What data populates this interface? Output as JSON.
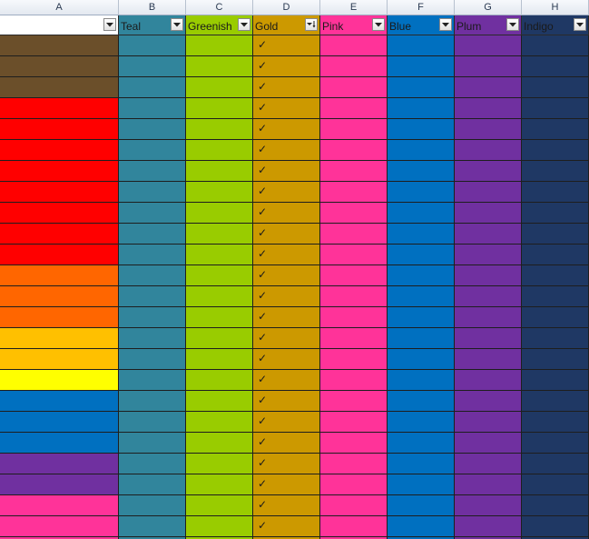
{
  "column_letters": [
    "A",
    "B",
    "C",
    "D",
    "E",
    "F",
    "G",
    "H"
  ],
  "filter_headers": [
    {
      "label": "",
      "bg": "#ffffff",
      "button_icon": "filter-dropdown-icon"
    },
    {
      "label": "Teal",
      "bg": "#31859c",
      "button_icon": "filter-dropdown-icon"
    },
    {
      "label": "Greenish",
      "bg": "#99cc00",
      "button_icon": "filter-dropdown-icon"
    },
    {
      "label": "Gold",
      "bg": "#cc9900",
      "button_icon": "filter-sort-active-icon"
    },
    {
      "label": "Pink",
      "bg": "#ff3399",
      "button_icon": "filter-dropdown-icon"
    },
    {
      "label": "Blue",
      "bg": "#0070c0",
      "button_icon": "filter-dropdown-icon"
    },
    {
      "label": "Plum",
      "bg": "#7030a0",
      "button_icon": "filter-dropdown-icon"
    },
    {
      "label": "Indigo",
      "bg": "#1f3864",
      "button_icon": "filter-dropdown-icon"
    }
  ],
  "column_colors": {
    "B": "#31859c",
    "C": "#99cc00",
    "D": "#cc9900",
    "E": "#ff3399",
    "F": "#0070c0",
    "G": "#7030a0",
    "H": "#1f3864"
  },
  "check_glyph": "✓",
  "rows": [
    {
      "a_color": "#6b4f2a"
    },
    {
      "a_color": "#6b4f2a"
    },
    {
      "a_color": "#6b4f2a"
    },
    {
      "a_color": "#ff0000"
    },
    {
      "a_color": "#ff0000"
    },
    {
      "a_color": "#ff0000"
    },
    {
      "a_color": "#ff0000"
    },
    {
      "a_color": "#ff0000"
    },
    {
      "a_color": "#ff0000"
    },
    {
      "a_color": "#ff0000"
    },
    {
      "a_color": "#ff0000"
    },
    {
      "a_color": "#ff6600"
    },
    {
      "a_color": "#ff6600"
    },
    {
      "a_color": "#ff6600"
    },
    {
      "a_color": "#ffc000"
    },
    {
      "a_color": "#ffc000"
    },
    {
      "a_color": "#ffff00"
    },
    {
      "a_color": "#0070c0"
    },
    {
      "a_color": "#0070c0"
    },
    {
      "a_color": "#0070c0"
    },
    {
      "a_color": "#7030a0"
    },
    {
      "a_color": "#7030a0"
    },
    {
      "a_color": "#ff3399"
    },
    {
      "a_color": "#ff3399"
    },
    {
      "a_color": "#ff3399"
    }
  ]
}
